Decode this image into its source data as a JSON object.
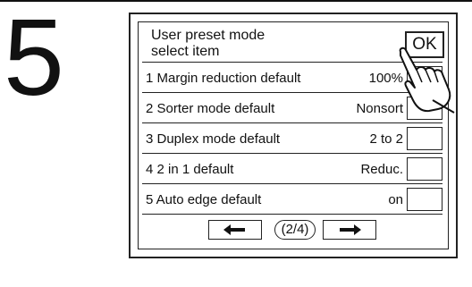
{
  "step": {
    "number": "5"
  },
  "panel": {
    "title_line1": "User preset mode",
    "title_line2": "select item",
    "ok_label": "OK"
  },
  "items": [
    {
      "label": "1 Margin reduction default",
      "value": "100%"
    },
    {
      "label": "2 Sorter mode default",
      "value": "Nonsort"
    },
    {
      "label": "3 Duplex mode default",
      "value": "2 to 2"
    },
    {
      "label": "4 2 in 1 default",
      "value": "Reduc."
    },
    {
      "label": "5 Auto edge default",
      "value": "on"
    }
  ],
  "nav": {
    "prev_icon": "left-arrow-icon",
    "next_icon": "right-arrow-icon",
    "page_indicator": "(2/4)"
  }
}
